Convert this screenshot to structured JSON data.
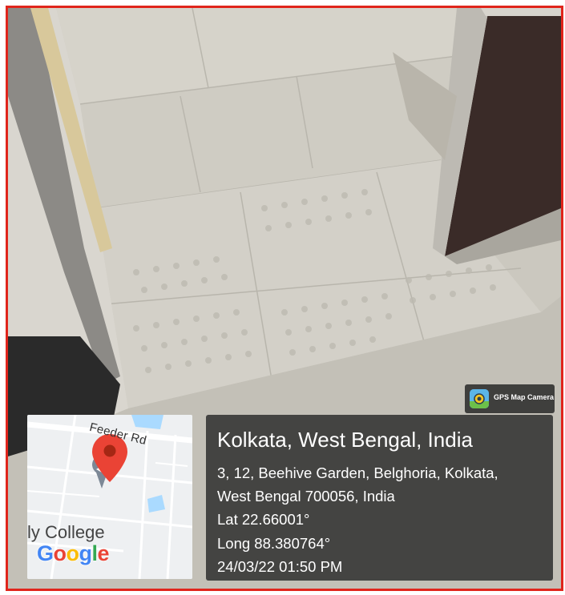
{
  "overlay": {
    "badge_label": "GPS Map Camera",
    "title": "Kolkata, West Bengal, India",
    "address_line1": "3, 12, Beehive Garden, Belghoria, Kolkata,",
    "address_line2": "West Bengal 700056, India",
    "latitude": "Lat 22.66001°",
    "longitude": "Long 88.380764°",
    "timestamp": "24/03/22 01:50 PM"
  },
  "map": {
    "road_label": "Feeder Rd",
    "poi_label": "ly College",
    "brand": "Google"
  },
  "colors": {
    "frame_border": "#e0251c",
    "pin": "#ea4335",
    "card_bg": "#282828"
  }
}
